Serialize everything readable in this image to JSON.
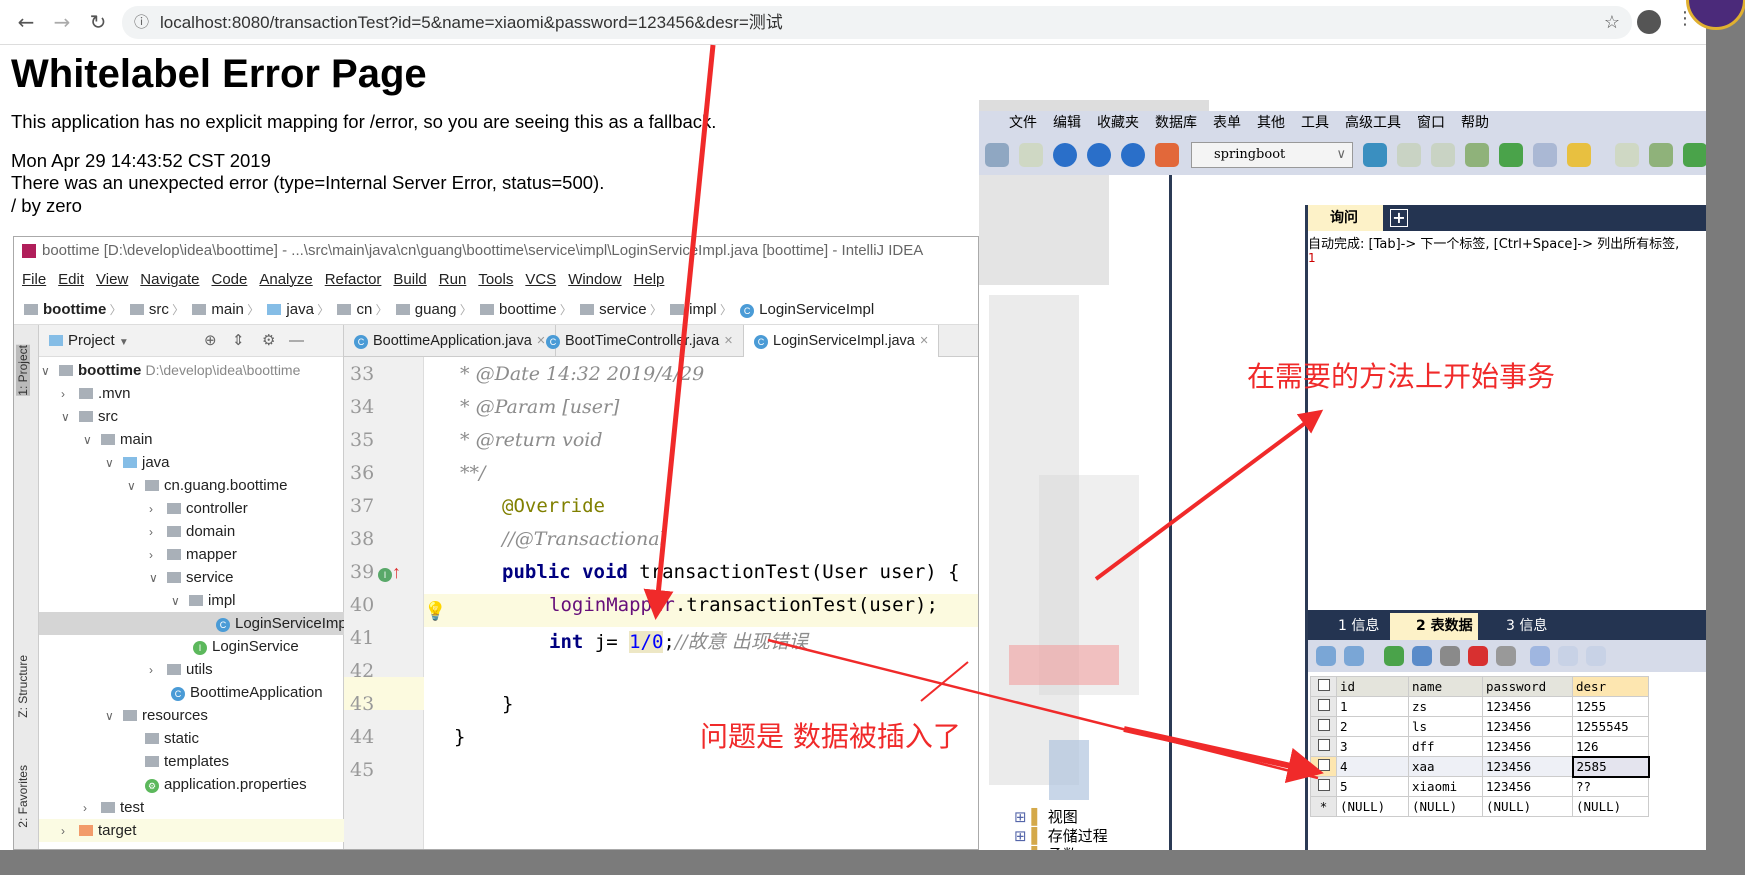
{
  "browser": {
    "url": "localhost:8080/transactionTest?id=5&name=xiaomi&password=123456&desr=测试"
  },
  "error_page": {
    "title": "Whitelabel Error Page",
    "message": "This application has no explicit mapping for /error, so you are seeing this as a fallback.",
    "timestamp": "Mon Apr 29 14:43:52 CST 2019",
    "error": "There was an unexpected error (type=Internal Server Error, status=500).",
    "detail": "/ by zero"
  },
  "ide": {
    "title": "boottime [D:\\develop\\idea\\boottime] - ...\\src\\main\\java\\cn\\guang\\boottime\\service\\impl\\LoginServiceImpl.java [boottime] - IntelliJ IDEA",
    "menu": [
      "File",
      "Edit",
      "View",
      "Navigate",
      "Code",
      "Analyze",
      "Refactor",
      "Build",
      "Run",
      "Tools",
      "VCS",
      "Window",
      "Help"
    ],
    "breadcrumb": [
      "boottime",
      "src",
      "main",
      "java",
      "cn",
      "guang",
      "boottime",
      "service",
      "impl",
      "LoginServiceImpl"
    ],
    "side_labels": {
      "project": "1: Project",
      "structure": "Z: Structure",
      "favorites": "2: Favorites"
    },
    "project_header": "Project",
    "tree": [
      {
        "label": "boottime",
        "extra": "D:\\develop\\idea\\boottime"
      },
      {
        "label": ".mvn"
      },
      {
        "label": "src"
      },
      {
        "label": "main"
      },
      {
        "label": "java"
      },
      {
        "label": "cn.guang.boottime"
      },
      {
        "label": "controller"
      },
      {
        "label": "domain"
      },
      {
        "label": "mapper"
      },
      {
        "label": "service"
      },
      {
        "label": "impl"
      },
      {
        "label": "LoginServiceImpl"
      },
      {
        "label": "LoginService"
      },
      {
        "label": "utils"
      },
      {
        "label": "BoottimeApplication"
      },
      {
        "label": "resources"
      },
      {
        "label": "static"
      },
      {
        "label": "templates"
      },
      {
        "label": "application.properties"
      },
      {
        "label": "test"
      },
      {
        "label": "target"
      }
    ],
    "tabs": [
      "BoottimeApplication.java",
      "BootTimeController.java",
      "LoginServiceImpl.java"
    ],
    "line_numbers": [
      "33",
      "34",
      "35",
      "36",
      "37",
      "38",
      "39",
      "40",
      "41",
      "42",
      "43",
      "44",
      "45"
    ],
    "code": {
      "l33": " * @Date 14:32 2019/4/29",
      "l34": " * @Param [user]",
      "l35": " * @return void",
      "l36": " **/",
      "l37": "@Override",
      "l38": "//@Transactional",
      "l39_kw": "public void",
      "l39_rest": " transactionTest(User user) {",
      "l40_field": "loginMapper",
      "l40_rest": ".transactionTest(user);",
      "l41_kw": "int",
      "l41_mid": " j= ",
      "l41_num": "1/0",
      "l41_semi": ";",
      "l41_comment": "//故意 出现错误",
      "l43": "}",
      "l44": "}"
    }
  },
  "navicat": {
    "menu": [
      "文件",
      "编辑",
      "收藏夹",
      "数据库",
      "表单",
      "其他",
      "工具",
      "高级工具",
      "窗口",
      "帮助"
    ],
    "database": "springboot",
    "query_tab": "询问",
    "autocomplete_hint": "自动完成: [Tab]-> 下一个标签, [Ctrl+Space]-> 列出所有标签,",
    "query_line": "1",
    "tree_items": [
      "视图",
      "存储过程",
      "函数"
    ],
    "result_tabs": [
      "1 信息",
      "2 表数据",
      "3 信息"
    ],
    "columns": [
      "id",
      "name",
      "password",
      "desr"
    ],
    "rows": [
      [
        "1",
        "zs",
        "123456",
        "1255"
      ],
      [
        "2",
        "ls",
        "123456",
        "1255545"
      ],
      [
        "3",
        "dff",
        "123456",
        "126"
      ],
      [
        "4",
        "xaa",
        "123456",
        "2585"
      ],
      [
        "5",
        "xiaomi",
        "123456",
        "??"
      ],
      [
        "(NULL)",
        "(NULL)",
        "(NULL)",
        "(NULL)"
      ]
    ]
  },
  "annotations": {
    "top": "在需要的方法上开始事务",
    "bottom": "问题是 数据被插入了",
    "color": "#f02a2a"
  }
}
